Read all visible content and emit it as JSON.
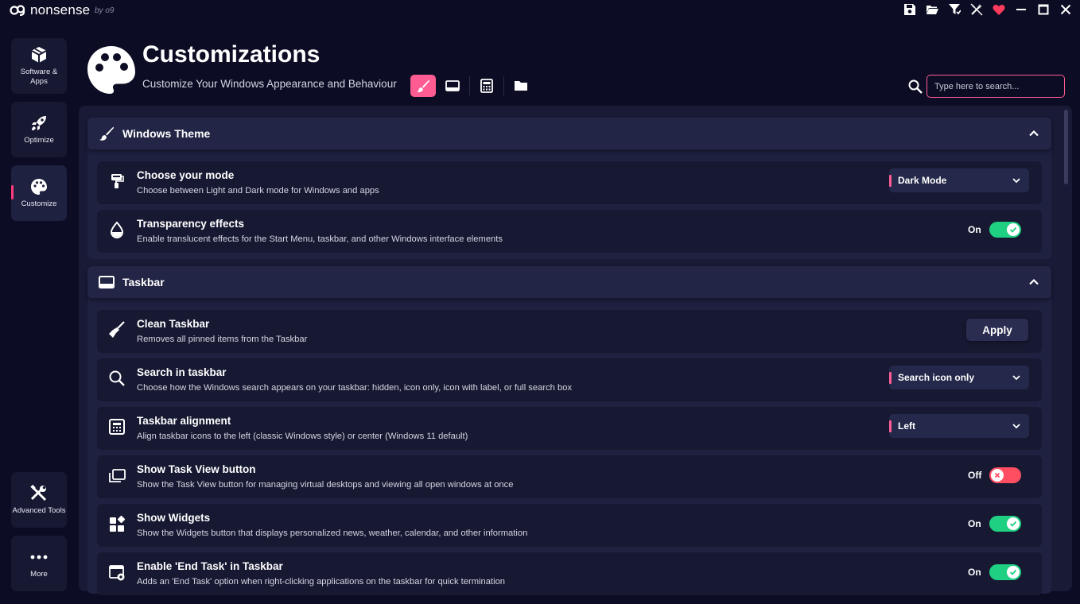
{
  "app": {
    "name": "nonsense",
    "by": "by o9"
  },
  "titlebar": {
    "icons": [
      "save-icon",
      "folder-open-icon",
      "filter-icon",
      "auto-fix-icon",
      "heart-icon",
      "minimize-icon",
      "maximize-icon",
      "close-icon"
    ]
  },
  "sidebar": {
    "items": [
      {
        "label": "Software & Apps",
        "icon": "package-icon"
      },
      {
        "label": "Optimize",
        "icon": "rocket-icon"
      },
      {
        "label": "Customize",
        "icon": "palette-icon",
        "active": true
      },
      {
        "label": "Advanced Tools",
        "icon": "tools-icon"
      },
      {
        "label": "More",
        "icon": "more-icon"
      }
    ]
  },
  "header": {
    "title": "Customizations",
    "subtitle": "Customize Your Windows Appearance and Behaviour",
    "categories": [
      "brush-icon",
      "taskbar-icon",
      "calculator-icon",
      "folder-icon"
    ]
  },
  "search": {
    "placeholder": "Type here to search..."
  },
  "sections": {
    "theme": {
      "title": "Windows Theme",
      "rows": {
        "mode": {
          "title": "Choose your mode",
          "desc": "Choose between Light and Dark mode for Windows and apps",
          "value": "Dark Mode"
        },
        "transparency": {
          "title": "Transparency effects",
          "desc": "Enable translucent effects for the Start Menu, taskbar, and other Windows interface elements",
          "state": "On"
        }
      }
    },
    "taskbar": {
      "title": "Taskbar",
      "rows": {
        "clean": {
          "title": "Clean Taskbar",
          "desc": "Removes all pinned items from the Taskbar",
          "button": "Apply"
        },
        "search": {
          "title": "Search in taskbar",
          "desc": "Choose how the Windows search appears on your taskbar: hidden, icon only, icon with label, or full search box",
          "value": "Search icon only"
        },
        "alignment": {
          "title": "Taskbar alignment",
          "desc": "Align taskbar icons to the left (classic Windows style) or center (Windows 11 default)",
          "value": "Left"
        },
        "taskview": {
          "title": "Show Task View button",
          "desc": "Show the Task View button for managing virtual desktops and viewing all open windows at once",
          "state": "Off"
        },
        "widgets": {
          "title": "Show Widgets",
          "desc": "Show the Widgets button that displays personalized news, weather, calendar, and other information",
          "state": "On"
        },
        "endtask": {
          "title": "Enable 'End Task' in Taskbar",
          "desc": "Adds an 'End Task' option when right-clicking applications on the taskbar for quick termination",
          "state": "On"
        }
      }
    }
  },
  "colors": {
    "accent": "#ff5c93",
    "toggle_on": "#1fcf82",
    "toggle_off": "#ff4d61",
    "background": "#0c0d24",
    "panel": "#181a36"
  }
}
